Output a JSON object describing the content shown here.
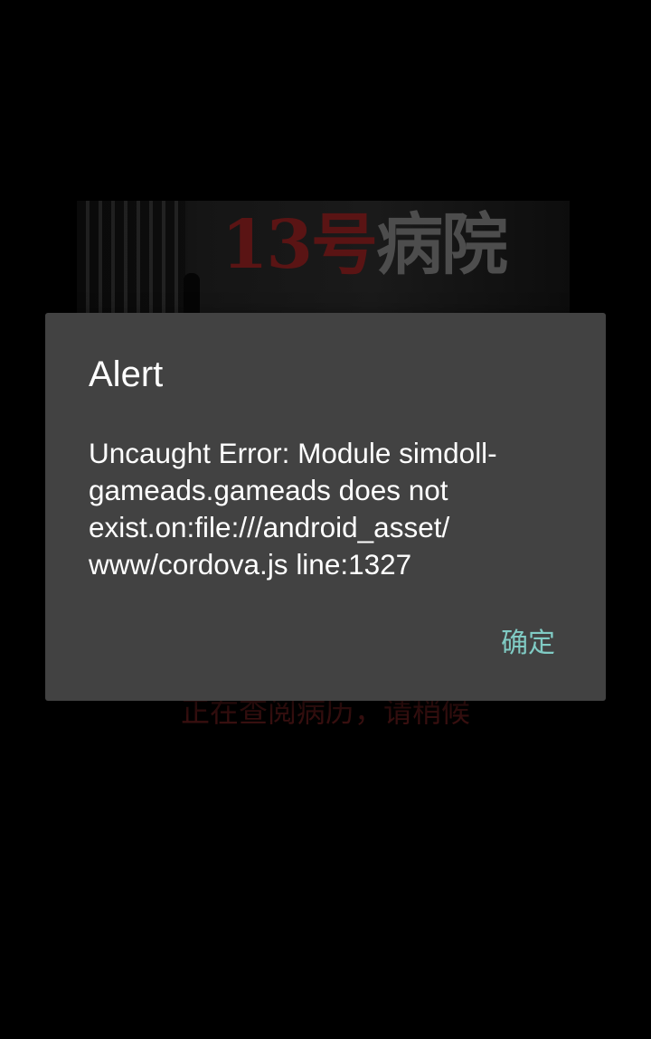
{
  "background": {
    "game_title_part1": "13号",
    "game_title_part2": "病院",
    "loading_text": "正在查阅病历，请稍候"
  },
  "dialog": {
    "title": "Alert",
    "message_lines": [
      "Uncaught Error: Module simdoll-",
      "gameads.gameads does not",
      "exist.on:file:///android_asset/",
      "www/cordova.js line:1327"
    ],
    "confirm_label": "确定"
  },
  "colors": {
    "dialog_background": "#424242",
    "button_accent": "#80cbc4",
    "screen_background": "#000000"
  }
}
